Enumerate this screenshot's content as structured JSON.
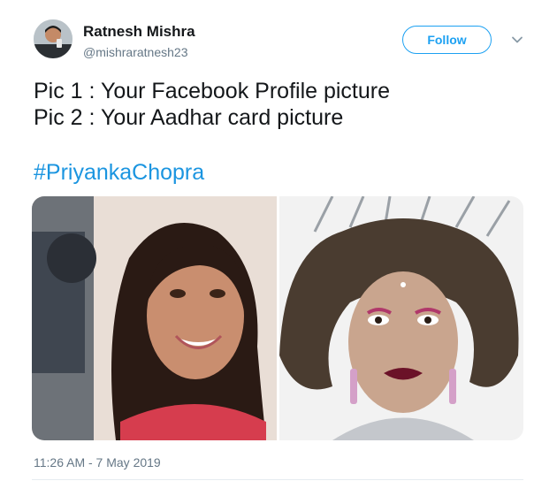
{
  "author": {
    "display_name": "Ratnesh Mishra",
    "handle": "@mishraratnesh23"
  },
  "follow_button": {
    "label": "Follow"
  },
  "tweet": {
    "lines": [
      "Pic 1 : Your Facebook Profile picture",
      "Pic 2 : Your Aadhar card picture"
    ],
    "hashtag": "#PriyankaChopra",
    "timestamp": "11:26 AM - 7 May 2019"
  },
  "colors": {
    "accent": "#1da1f2",
    "hashtag": "#1b95e0",
    "secondary_text": "#657786"
  },
  "icons": [
    "chevron-down-icon"
  ]
}
